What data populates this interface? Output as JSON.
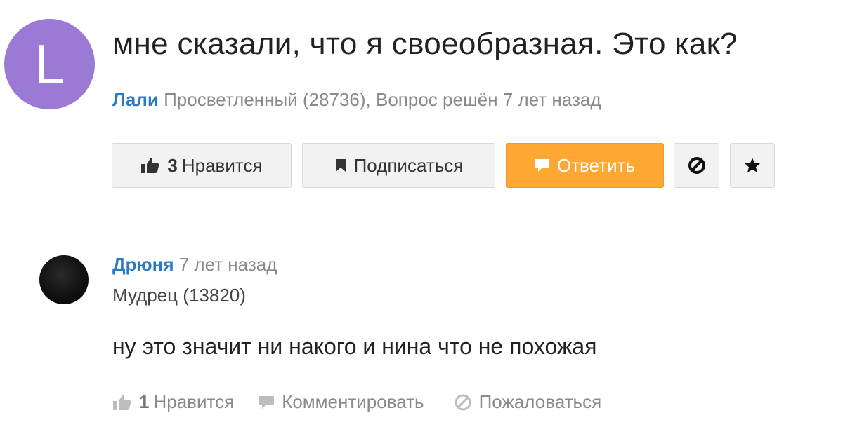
{
  "question": {
    "avatar_letter": "L",
    "title": "мне сказали, что я своеобразная. Это как?",
    "author": "Лали",
    "meta": "Просветленный (28736), Вопрос решён 7 лет назад",
    "buttons": {
      "like_count": "3",
      "like_label": "Нравится",
      "subscribe_label": "Подписаться",
      "answer_label": "Ответить"
    },
    "icons": [
      "thumbs-up-icon",
      "bookmark-icon",
      "comment-icon",
      "block-icon",
      "star-icon"
    ]
  },
  "answer": {
    "author": "Дрюня",
    "time": "7 лет назад",
    "rank": "Мудрец (13820)",
    "text": "ну это значит ни накого и нина что не похожая",
    "actions": {
      "like_count": "1",
      "like_label": "Нравится",
      "comment_label": "Комментировать",
      "report_label": "Пожаловаться"
    }
  },
  "colors": {
    "accent_blue": "#2b7bc4",
    "answer_button": "#ffa733",
    "avatar_purple": "#9b7ad6"
  }
}
